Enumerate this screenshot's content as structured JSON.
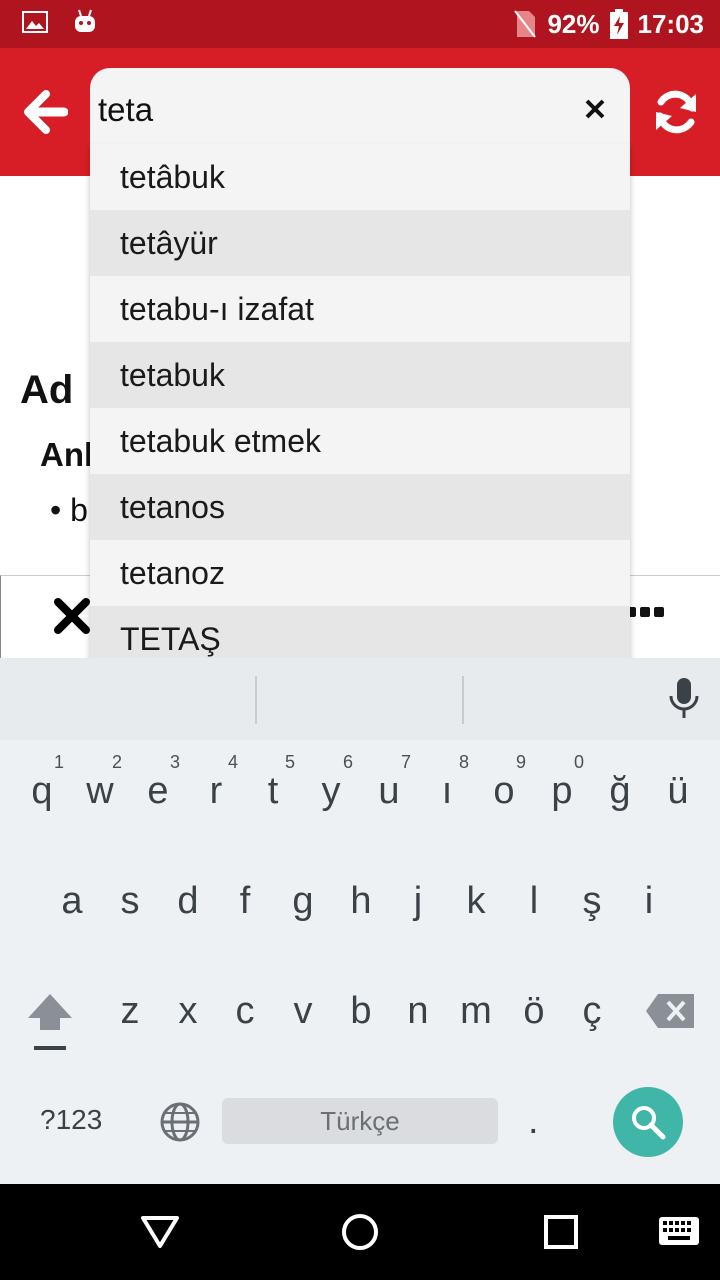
{
  "status_bar": {
    "battery": "92%",
    "time": "17:03"
  },
  "search": {
    "value": "teta",
    "placeholder": ""
  },
  "suggestions": [
    "tetâbuk",
    "tetâyür",
    "tetabu-ı izafat",
    "tetabuk",
    "tetabuk etmek",
    "tetanos",
    "tetanoz",
    "TETAŞ"
  ],
  "background_content": {
    "heading": "Ad",
    "subheading": "Anl",
    "bullet": "• b"
  },
  "keyboard": {
    "row1": [
      "q",
      "w",
      "e",
      "r",
      "t",
      "y",
      "u",
      "ı",
      "o",
      "p",
      "ğ",
      "ü"
    ],
    "row1_hints": [
      "1",
      "2",
      "3",
      "4",
      "5",
      "6",
      "7",
      "8",
      "9",
      "0"
    ],
    "row2": [
      "a",
      "s",
      "d",
      "f",
      "g",
      "h",
      "j",
      "k",
      "l",
      "ş",
      "i"
    ],
    "row3": [
      "z",
      "x",
      "c",
      "v",
      "b",
      "n",
      "m",
      "ö",
      "ç"
    ],
    "symbols_label": "?123",
    "space_label": "Türkçe",
    "period_label": "."
  },
  "colors": {
    "status_bar": "#b0141e",
    "app_bar": "#d71e26",
    "search_key": "#3fb6a8"
  }
}
